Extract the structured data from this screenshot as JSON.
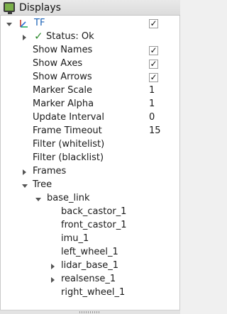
{
  "window": {
    "title": "Displays"
  },
  "tf": {
    "label": "TF",
    "enabled_check": "✓"
  },
  "status": {
    "check": "✓",
    "label": "Status: Ok"
  },
  "properties": [
    {
      "label": "Show Names",
      "check": "✓"
    },
    {
      "label": "Show Axes",
      "check": "✓"
    },
    {
      "label": "Show Arrows",
      "check": "✓"
    },
    {
      "label": "Marker Scale",
      "value": "1"
    },
    {
      "label": "Marker Alpha",
      "value": "1"
    },
    {
      "label": "Update Interval",
      "value": "0"
    },
    {
      "label": "Frame Timeout",
      "value": "15"
    },
    {
      "label": "Filter (whitelist)"
    },
    {
      "label": "Filter (blacklist)"
    }
  ],
  "frames": {
    "label": "Frames"
  },
  "tree": {
    "label": "Tree",
    "root": "base_link",
    "children": [
      {
        "label": "back_castor_1"
      },
      {
        "label": "front_castor_1"
      },
      {
        "label": "imu_1"
      },
      {
        "label": "left_wheel_1"
      },
      {
        "label": "lidar_base_1",
        "expandable": true
      },
      {
        "label": "realsense_1",
        "expandable": true
      },
      {
        "label": "right_wheel_1"
      }
    ]
  },
  "colors": {
    "tf_label": "#1c63b7",
    "status_ok": "#2e8b2e"
  }
}
